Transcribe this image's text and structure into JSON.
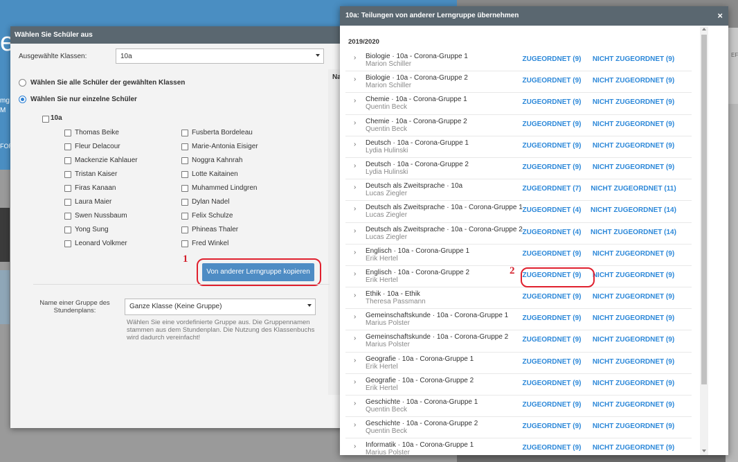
{
  "background": {
    "hero_letter": "e",
    "side_texts": [
      "mg",
      "M",
      "FOR"
    ],
    "right_hint": "EF"
  },
  "left_modal": {
    "title": "Wählen Sie Schüler aus",
    "klassen_label": "Ausgewählte Klassen:",
    "klassen_value": "10a",
    "radio_all": "Wählen Sie alle Schüler der gewählten Klassen",
    "radio_single": "Wählen Sie nur einzelne Schüler",
    "class_checkbox": "10a",
    "students_col1": [
      "Thomas Beike",
      "Fleur Delacour",
      "Mackenzie Kahlauer",
      "Tristan Kaiser",
      "Firas Kanaan",
      "Laura Maier",
      "Swen Nussbaum",
      "Yong Sung",
      "Leonard Volkmer"
    ],
    "students_col2": [
      "Fusberta Bordeleau",
      "Marie-Antonia Eisiger",
      "Noggra Kahnrah",
      "Lotte Kaitainen",
      "Muhammed Lindgren",
      "Dylan Nadel",
      "Felix Schulze",
      "Phineas Thaler",
      "Fred Winkel"
    ],
    "copy_button": "Von anderer Lerngruppe kopieren",
    "group_label": "Name einer Gruppe des Stundenplans:",
    "group_value": "Ganze Klasse (Keine Gruppe)",
    "help_text": "Wählen Sie eine vordefinierte Gruppe aus. Die Gruppennamen stammen aus dem Stundenplan. Die Nutzung des Klassenbuchs wird dadurch vereinfacht!",
    "side_stub": "Na"
  },
  "annotations": {
    "one": "1",
    "two": "2"
  },
  "right_modal": {
    "title": "10a: Teilungen von anderer Lerngruppe übernehmen",
    "close": "×",
    "year": "2019/2020",
    "items": [
      {
        "title": "Biologie · 10a - Corona-Gruppe 1",
        "teacher": "Marion Schiller",
        "zu": "ZUGEORDNET (9)",
        "nz": "NICHT ZUGEORDNET (9)"
      },
      {
        "title": "Biologie · 10a - Corona-Gruppe 2",
        "teacher": "Marion Schiller",
        "zu": "ZUGEORDNET (9)",
        "nz": "NICHT ZUGEORDNET (9)"
      },
      {
        "title": "Chemie · 10a - Corona-Gruppe 1",
        "teacher": "Quentin Beck",
        "zu": "ZUGEORDNET (9)",
        "nz": "NICHT ZUGEORDNET (9)"
      },
      {
        "title": "Chemie · 10a - Corona-Gruppe 2",
        "teacher": "Quentin Beck",
        "zu": "ZUGEORDNET (9)",
        "nz": "NICHT ZUGEORDNET (9)"
      },
      {
        "title": "Deutsch · 10a - Corona-Gruppe 1",
        "teacher": "Lydia Hulinski",
        "zu": "ZUGEORDNET (9)",
        "nz": "NICHT ZUGEORDNET (9)"
      },
      {
        "title": "Deutsch · 10a - Corona-Gruppe 2",
        "teacher": "Lydia Hulinski",
        "zu": "ZUGEORDNET (9)",
        "nz": "NICHT ZUGEORDNET (9)"
      },
      {
        "title": "Deutsch als Zweitsprache · 10a",
        "teacher": "Lucas Ziegler",
        "zu": "ZUGEORDNET (7)",
        "nz": "NICHT ZUGEORDNET (11)"
      },
      {
        "title": "Deutsch als Zweitsprache · 10a - Corona-Gruppe 1",
        "teacher": "Lucas Ziegler",
        "zu": "ZUGEORDNET (4)",
        "nz": "NICHT ZUGEORDNET (14)"
      },
      {
        "title": "Deutsch als Zweitsprache · 10a - Corona-Gruppe 2",
        "teacher": "Lucas Ziegler",
        "zu": "ZUGEORDNET (4)",
        "nz": "NICHT ZUGEORDNET (14)"
      },
      {
        "title": "Englisch · 10a - Corona-Gruppe 1",
        "teacher": "Erik Hertel",
        "zu": "ZUGEORDNET (9)",
        "nz": "NICHT ZUGEORDNET (9)"
      },
      {
        "title": "Englisch · 10a - Corona-Gruppe 2",
        "teacher": "Erik Hertel",
        "zu": "ZUGEORDNET (9)",
        "nz": "NICHT ZUGEORDNET (9)"
      },
      {
        "title": "Ethik · 10a - Ethik",
        "teacher": "Theresa Passmann",
        "zu": "ZUGEORDNET (9)",
        "nz": "NICHT ZUGEORDNET (9)"
      },
      {
        "title": "Gemeinschaftskunde · 10a - Corona-Gruppe 1",
        "teacher": "Marius Polster",
        "zu": "ZUGEORDNET (9)",
        "nz": "NICHT ZUGEORDNET (9)"
      },
      {
        "title": "Gemeinschaftskunde · 10a - Corona-Gruppe 2",
        "teacher": "Marius Polster",
        "zu": "ZUGEORDNET (9)",
        "nz": "NICHT ZUGEORDNET (9)"
      },
      {
        "title": "Geografie · 10a - Corona-Gruppe 1",
        "teacher": "Erik Hertel",
        "zu": "ZUGEORDNET (9)",
        "nz": "NICHT ZUGEORDNET (9)"
      },
      {
        "title": "Geografie · 10a - Corona-Gruppe 2",
        "teacher": "Erik Hertel",
        "zu": "ZUGEORDNET (9)",
        "nz": "NICHT ZUGEORDNET (9)"
      },
      {
        "title": "Geschichte · 10a - Corona-Gruppe 1",
        "teacher": "Quentin Beck",
        "zu": "ZUGEORDNET (9)",
        "nz": "NICHT ZUGEORDNET (9)"
      },
      {
        "title": "Geschichte · 10a - Corona-Gruppe 2",
        "teacher": "Quentin Beck",
        "zu": "ZUGEORDNET (9)",
        "nz": "NICHT ZUGEORDNET (9)"
      },
      {
        "title": "Informatik · 10a - Corona-Gruppe 1",
        "teacher": "Marius Polster",
        "zu": "ZUGEORDNET (9)",
        "nz": "NICHT ZUGEORDNET (9)"
      }
    ]
  },
  "colors": {
    "header": "#5a6770",
    "link": "#2c88d9",
    "button": "#4e8cc4",
    "annotation_red": "#e0202e"
  }
}
